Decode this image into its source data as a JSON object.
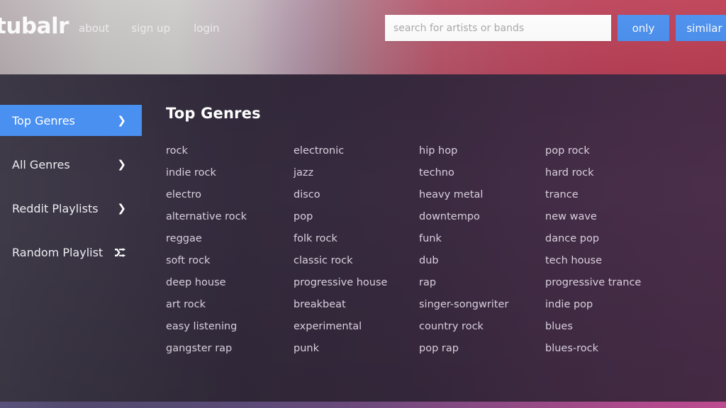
{
  "header": {
    "logo": "tubalr",
    "nav": [
      {
        "id": "about",
        "label": "about"
      },
      {
        "id": "signup",
        "label": "sign up"
      },
      {
        "id": "login",
        "label": "login"
      }
    ],
    "search": {
      "placeholder": "search for artists or bands",
      "value": ""
    },
    "buttons": {
      "only": "only",
      "similar": "similar"
    },
    "colors": {
      "gradient_start": "#cdcbca",
      "gradient_end": "#be3f54",
      "button_blue": "#4a90f0"
    }
  },
  "sidebar": {
    "items": [
      {
        "label": "Top Genres",
        "icon": "chevron-right-icon",
        "active": true
      },
      {
        "label": "All Genres",
        "icon": "chevron-right-icon",
        "active": false
      },
      {
        "label": "Reddit Playlists",
        "icon": "chevron-right-icon",
        "active": false
      },
      {
        "label": "Random Playlist",
        "icon": "shuffle-icon",
        "active": false
      }
    ],
    "active_color": "#4a90f0"
  },
  "main": {
    "title": "Top Genres",
    "genres": [
      "rock",
      "electronic",
      "hip hop",
      "pop rock",
      "indie rock",
      "jazz",
      "techno",
      "hard rock",
      "electro",
      "disco",
      "heavy metal",
      "trance",
      "alternative rock",
      "pop",
      "downtempo",
      "new wave",
      "reggae",
      "folk rock",
      "funk",
      "dance pop",
      "soft rock",
      "classic rock",
      "dub",
      "tech house",
      "deep house",
      "progressive house",
      "rap",
      "progressive trance",
      "art rock",
      "breakbeat",
      "singer-songwriter",
      "indie pop",
      "easy listening",
      "experimental",
      "country rock",
      "blues",
      "gangster rap",
      "punk",
      "pop rap",
      "blues-rock"
    ],
    "columns": 4,
    "colors": {
      "bg_left": "#403b49",
      "bg_right": "#4b2e4a",
      "text": "#d9cfdd"
    }
  },
  "footer": {
    "strip_start": "#58527a",
    "strip_end": "#bd4b90"
  }
}
